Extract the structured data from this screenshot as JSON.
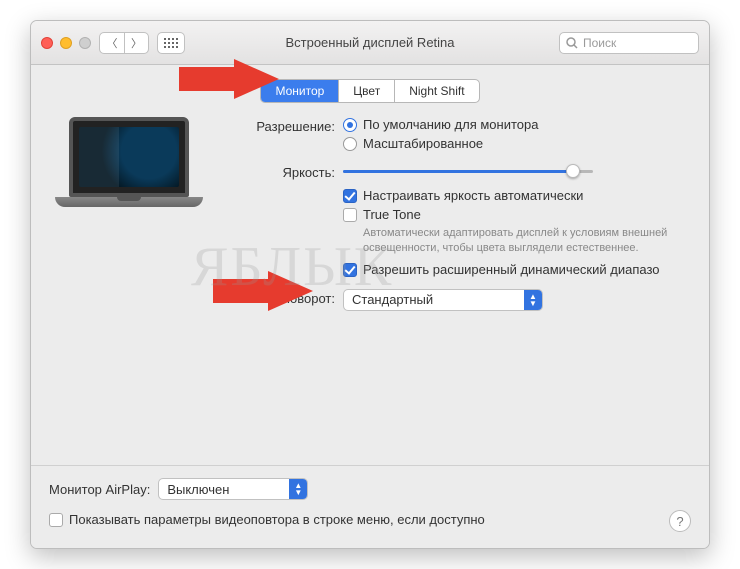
{
  "window": {
    "title": "Встроенный дисплей Retina"
  },
  "search": {
    "placeholder": "Поиск"
  },
  "tabs": {
    "monitor": "Монитор",
    "color": "Цвет",
    "night_shift": "Night Shift"
  },
  "resolution": {
    "label": "Разрешение:",
    "default": "По умолчанию для монитора",
    "scaled": "Масштабированное"
  },
  "brightness": {
    "label": "Яркость:",
    "auto_label": "Настраивать яркость автоматически"
  },
  "true_tone": {
    "label": "True Tone",
    "hint": "Автоматически адаптировать дисплей к условиям внешней освещенности, чтобы цвета выглядели естественнее."
  },
  "hdr": {
    "label": "Разрешить расширенный динамический диапазо"
  },
  "rotation": {
    "label": "Поворот:",
    "value": "Стандартный"
  },
  "airplay": {
    "label": "Монитор AirPlay:",
    "value": "Выключен"
  },
  "show_mirroring": {
    "label": "Показывать параметры видеоповтора в строке меню, если доступно"
  },
  "watermark": "ЯБЛЫК"
}
